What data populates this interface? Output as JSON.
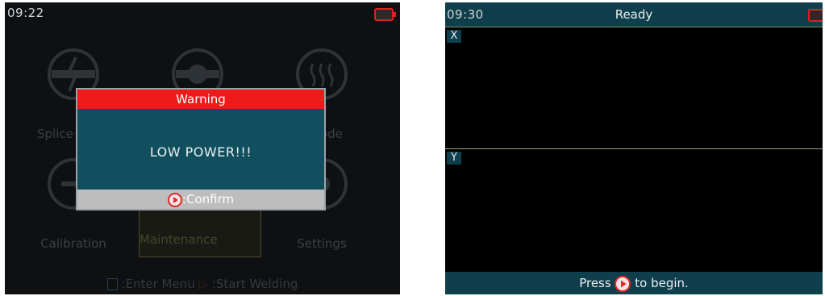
{
  "left_screen": {
    "time": "09:22",
    "menu": {
      "items": [
        {
          "label": "Splice",
          "icon": "splice-icon"
        },
        {
          "label": "",
          "icon": "gear-icon"
        },
        {
          "label": "Mode",
          "icon": "heater-icon"
        },
        {
          "label": "Calibration",
          "icon": "calibration-icon"
        },
        {
          "label": "Maintenance",
          "icon": "maintenance-icon"
        },
        {
          "label": "Settings",
          "icon": "settings-icon"
        }
      ],
      "footer_enter": "Enter Menu",
      "footer_start": "Start Welding"
    },
    "dialog": {
      "title": "Warning",
      "message": "LOW POWER!!!",
      "confirm_label": "Confirm"
    }
  },
  "right_screen": {
    "time": "09:30",
    "status": "Ready",
    "panels": [
      {
        "axis": "X"
      },
      {
        "axis": "Y"
      }
    ],
    "footer_press": "Press",
    "footer_begin": "to begin."
  },
  "colors": {
    "warning_red": "#ee1b1b",
    "dialog_teal": "#114f5e",
    "battery_red": "#e02020"
  }
}
